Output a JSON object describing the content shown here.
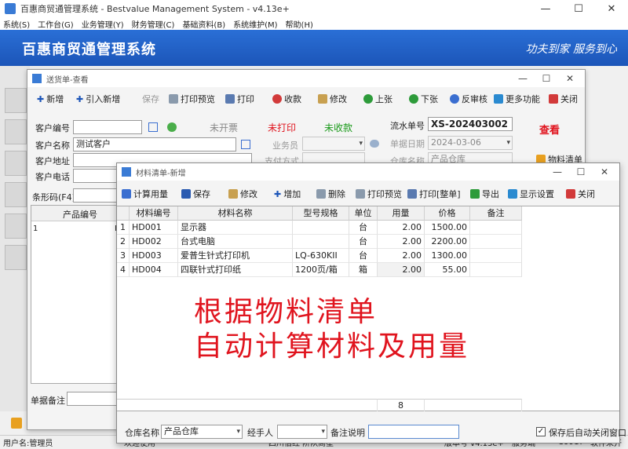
{
  "main": {
    "title": "百惠商贸通管理系统 - Bestvalue Management System - v4.13e+",
    "menu": [
      "系统(S)",
      "工作台(G)",
      "业务管理(Y)",
      "财务管理(C)",
      "基础资料(B)",
      "系统维护(M)",
      "帮助(H)"
    ],
    "banner_title": "百惠商贸通管理系统",
    "banner_slogan": "功夫到家  服务到心",
    "status": {
      "user": "用户名:管理员",
      "welcome": "欢迎使用",
      "mid": "四川佰红  阶队商星",
      "version": "版本号 v4.13e+",
      "service": "服务端",
      "num": "39917",
      "right": "软件未开"
    }
  },
  "delivery": {
    "title": "送货单-查看",
    "toolbar": {
      "new": "新增",
      "import_new": "引入新增",
      "save": "保存",
      "print_preview": "打印预览",
      "print": "打印",
      "collect": "收款",
      "edit": "修改",
      "prev": "上张",
      "next": "下张",
      "unaudit": "反审核",
      "more": "更多功能",
      "close": "关闭"
    },
    "fields": {
      "customer_no_label": "客户编号",
      "customer_no": "",
      "customer_name_label": "客户名称",
      "customer_name": "测试客户",
      "customer_addr_label": "客户地址",
      "customer_addr": "",
      "customer_phone_label": "客户电话",
      "customer_phone": "",
      "barcode_label": "条形码(F4)",
      "barcode": "",
      "salesman_label": "业务员",
      "salesman": "",
      "pay_label": "支付方式",
      "pay": "",
      "serial_label": "流水单号",
      "serial": "XS-202403002",
      "date_label": "单据日期",
      "date": "2024-03-06",
      "warehouse_label": "仓库名称",
      "warehouse": "产品仓库",
      "remark_label": "单据备注",
      "remark": ""
    },
    "status": {
      "invoice": "未开票",
      "printed": "未打印",
      "collected": "未收款",
      "view": "查看"
    },
    "material_btn": "物料清单",
    "grid_header": "产品编号",
    "grid_row_no": "1",
    "grid_row_mark": "E"
  },
  "material": {
    "title": "材料清单-新增",
    "toolbar": {
      "calc": "计算用量",
      "save": "保存",
      "edit": "修改",
      "add": "增加",
      "delete": "删除",
      "print_preview": "打印预览",
      "print_full": "打印[整单]",
      "export": "导出",
      "display_settings": "显示设置",
      "close": "关闭"
    },
    "columns": [
      "材料编号",
      "材料名称",
      "型号规格",
      "单位",
      "用量",
      "价格",
      "备注"
    ],
    "rows": [
      {
        "no": "1",
        "code": "HD001",
        "name": "显示器",
        "spec": "",
        "unit": "台",
        "qty": "2.00",
        "price": "1500.00",
        "note": ""
      },
      {
        "no": "2",
        "code": "HD002",
        "name": "台式电脑",
        "spec": "",
        "unit": "台",
        "qty": "2.00",
        "price": "2200.00",
        "note": ""
      },
      {
        "no": "3",
        "code": "HD003",
        "name": "爱普生针式打印机",
        "spec": "LQ-630KII",
        "unit": "台",
        "qty": "2.00",
        "price": "1300.00",
        "note": ""
      },
      {
        "no": "4",
        "code": "HD004",
        "name": "四联针式打印纸",
        "spec": "1200页/箱",
        "unit": "箱",
        "qty": "2.00",
        "price": "55.00",
        "note": ""
      }
    ],
    "sum_qty": "8",
    "overlay_line1": "根据物料清单",
    "overlay_line2": "自动计算材料及用量",
    "footer": {
      "warehouse_label": "仓库名称",
      "warehouse": "产品仓库",
      "handler_label": "经手人",
      "handler": "",
      "note_label": "备注说明",
      "note": "",
      "auto_close": "保存后自动关闭窗口",
      "auto_close_checked": true
    }
  },
  "colors": {
    "banner": "#2a6fd6",
    "red": "#e0141e",
    "green": "#1a9a1a"
  }
}
